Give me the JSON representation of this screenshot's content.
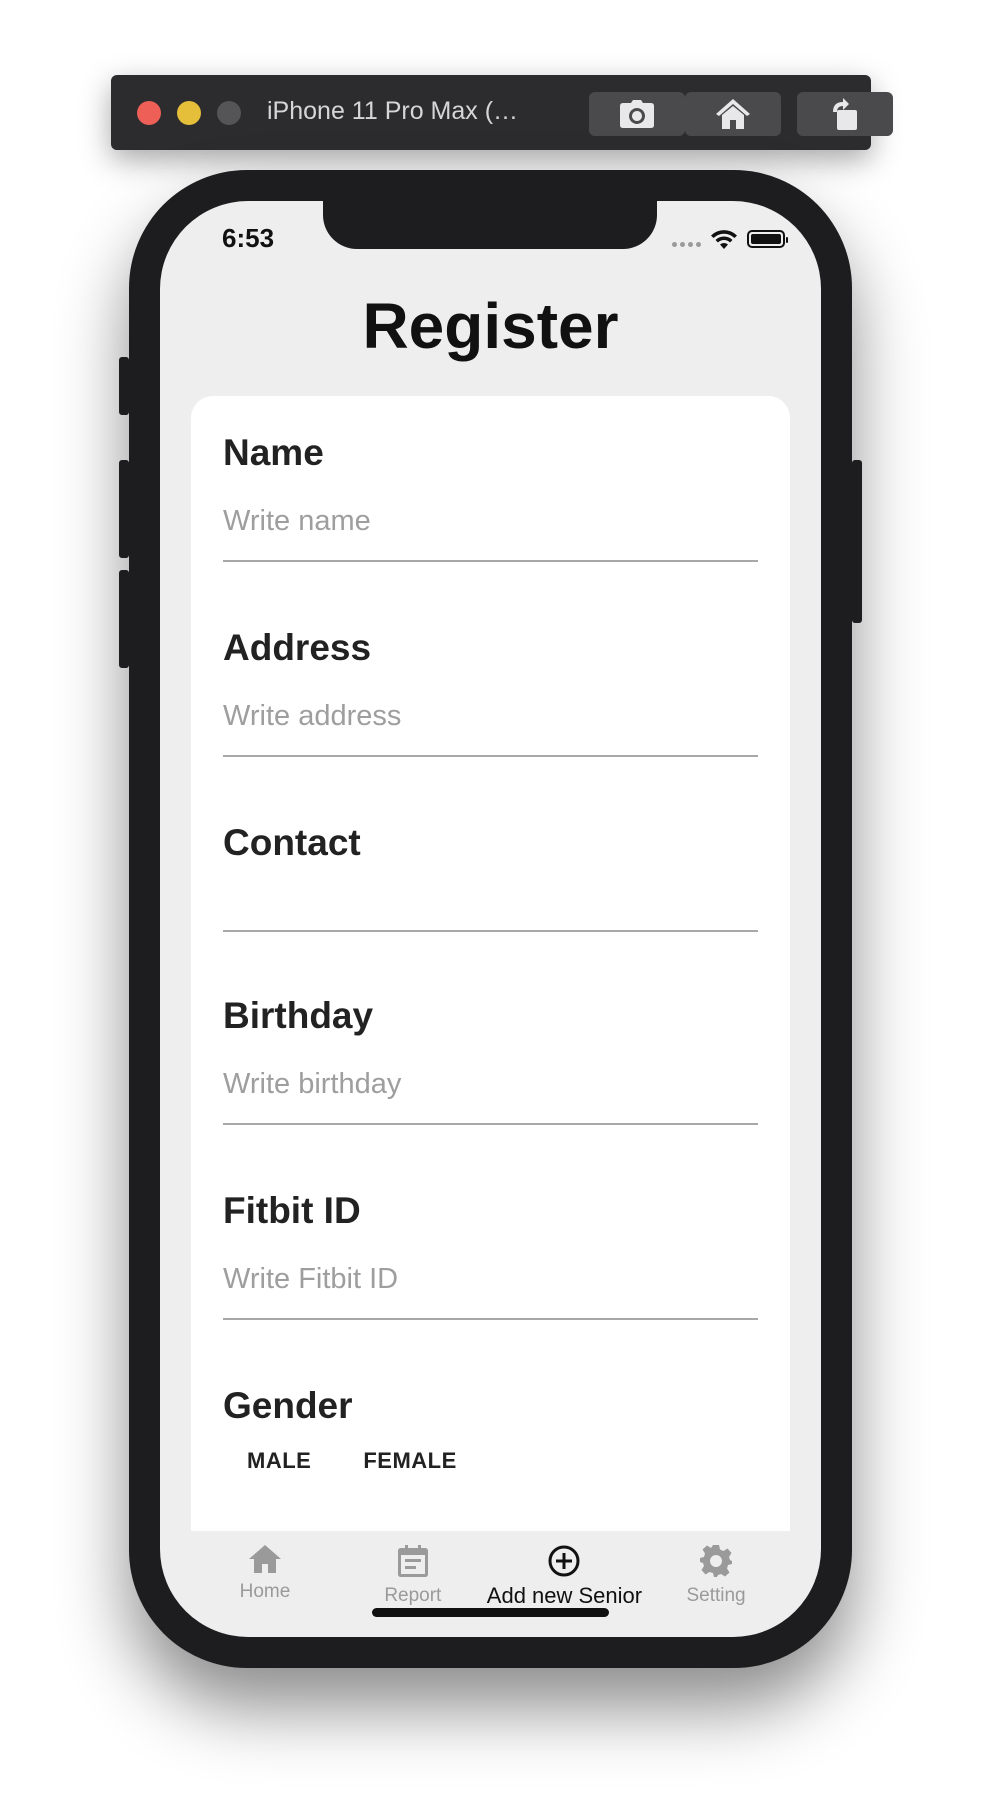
{
  "simulator": {
    "title": "iPhone 11 Pro Max (…"
  },
  "status_bar": {
    "time": "6:53"
  },
  "page": {
    "title": "Register"
  },
  "form": {
    "name": {
      "label": "Name",
      "value": "",
      "placeholder": "Write name"
    },
    "address": {
      "label": "Address",
      "value": "",
      "placeholder": "Write address"
    },
    "contact": {
      "label": "Contact",
      "value": "",
      "placeholder": ""
    },
    "birthday": {
      "label": "Birthday",
      "value": "",
      "placeholder": "Write birthday"
    },
    "fitbit": {
      "label": "Fitbit ID",
      "value": "",
      "placeholder": "Write Fitbit ID"
    },
    "gender": {
      "label": "Gender",
      "options": [
        "MALE",
        "FEMALE"
      ]
    }
  },
  "tabbar": {
    "active_tab": "Add new Senior",
    "tabs": [
      {
        "label": "Home",
        "icon": "home-icon"
      },
      {
        "label": "Report",
        "icon": "calendar-icon"
      },
      {
        "label": "Add new Senior",
        "icon": "plus-circle-icon"
      },
      {
        "label": "Setting",
        "icon": "gear-icon"
      }
    ]
  },
  "colors": {
    "background": "#eeeeee",
    "card": "#ffffff",
    "inactive_tab": "#9a9a9a",
    "active_tab": "#111111",
    "placeholder": "#9e9e9e"
  }
}
